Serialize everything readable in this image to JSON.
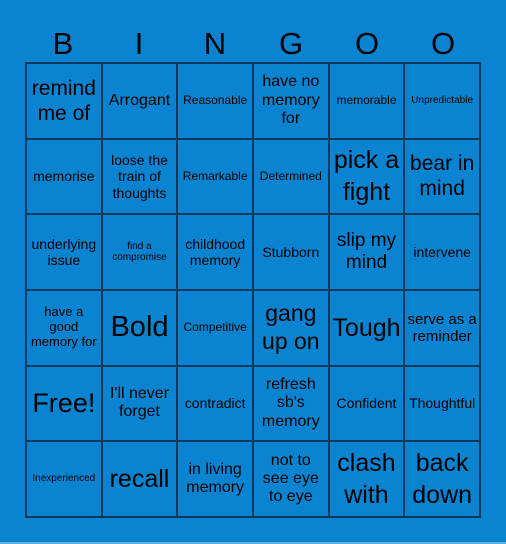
{
  "header": [
    "B",
    "I",
    "N",
    "G",
    "O",
    "O"
  ],
  "theme": {
    "background": "#0a84d0",
    "grid_line": "#0c3a5c",
    "text": "#000000"
  },
  "cells": [
    [
      "remind me of",
      "Arrogant",
      "Reasonable",
      "have no memory for",
      "memorable",
      "Unpredictable"
    ],
    [
      "memorise",
      "loose the train of thoughts",
      "Remarkable",
      "Determined",
      "pick a fight",
      "bear in mind"
    ],
    [
      "underlying issue",
      "find a compromise",
      "childhood memory",
      "Stubborn",
      "slip my mind",
      "intervene"
    ],
    [
      "have a good memory for",
      "Bold",
      "Competitive",
      "gang up on",
      "Tough",
      "serve as a reminder"
    ],
    [
      "Free!",
      "I'll never forget",
      "contradict",
      "refresh sb's memory",
      "Confident",
      "Thoughtful"
    ],
    [
      "Inexperienced",
      "recall",
      "in living memory",
      "not to see eye to eye",
      "clash with",
      "back down"
    ]
  ]
}
